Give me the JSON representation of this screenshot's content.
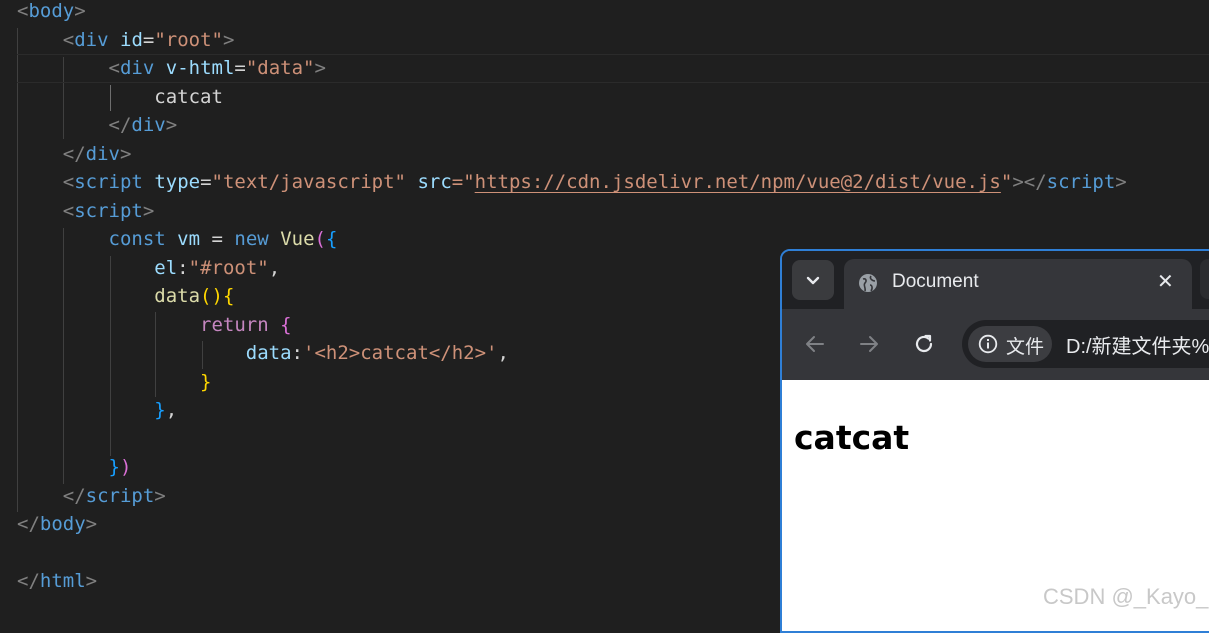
{
  "editor": {
    "lines": {
      "l1": {
        "open": "<",
        "tag": "body",
        "close": ">"
      },
      "l2": {
        "open": "<",
        "tag": "div",
        "attr": "id",
        "eq": "=",
        "val": "\"root\"",
        "close": ">"
      },
      "l3": {
        "open": "<",
        "tag": "div",
        "attr": "v-html",
        "eq": "=",
        "val": "\"data\"",
        "close": ">"
      },
      "l4": {
        "text": "catcat"
      },
      "l5": {
        "open": "</",
        "tag": "div",
        "close": ">"
      },
      "l6": {
        "open": "</",
        "tag": "div",
        "close": ">"
      },
      "l7": {
        "open": "<",
        "tag": "script",
        "attr1": "type",
        "eq1": "=",
        "val1": "\"text/javascript\"",
        "attr2": "src",
        "eq2": "=\"",
        "url": "https://cdn.jsdelivr.net/npm/vue@2/dist/vue.js",
        "q": "\"",
        "close": "></",
        "tag2": "script",
        "close2": ">"
      },
      "l8": {
        "open": "<",
        "tag": "script",
        "close": ">"
      },
      "l9": {
        "kw": "const",
        "var": "vm",
        "op": "=",
        "kw2": "new",
        "cls": "Vue",
        "p": "(",
        "b": "{"
      },
      "l10": {
        "prop": "el",
        "colon": ":",
        "str": "\"#root\"",
        "comma": ","
      },
      "l11": {
        "fn": "data",
        "p": "()",
        "b": "{"
      },
      "l12": {
        "kw": "return",
        "b": "{"
      },
      "l13": {
        "prop": "data",
        "colon": ":",
        "str": "'<h2>catcat</h2>'",
        "comma": ","
      },
      "l14": {
        "b": "}"
      },
      "l15": {
        "b": "}",
        "comma": ","
      },
      "l17": {
        "b": "}",
        "p": ")"
      },
      "l18": {
        "open": "</",
        "tag": "script",
        "close": ">"
      },
      "l19": {
        "open": "</",
        "tag": "body",
        "close": ">"
      },
      "l21": {
        "open": "</",
        "tag": "html",
        "close": ">"
      }
    }
  },
  "browser": {
    "tab_title": "Document",
    "close_glyph": "✕",
    "chip_label": "文件",
    "url": "D:/新建文件夹%",
    "page_heading": "catcat"
  },
  "colors": {
    "editor_bg": "#1f1f1f",
    "browser_border": "#2f7fd6",
    "tag": "#569cd6",
    "attr": "#9cdcfe",
    "string": "#ce9178"
  },
  "icons": [
    "chevron-down-icon",
    "globe-icon",
    "close-icon",
    "back-arrow-icon",
    "forward-arrow-icon",
    "reload-icon",
    "info-icon"
  ],
  "watermark": "CSDN @_Kayo_"
}
